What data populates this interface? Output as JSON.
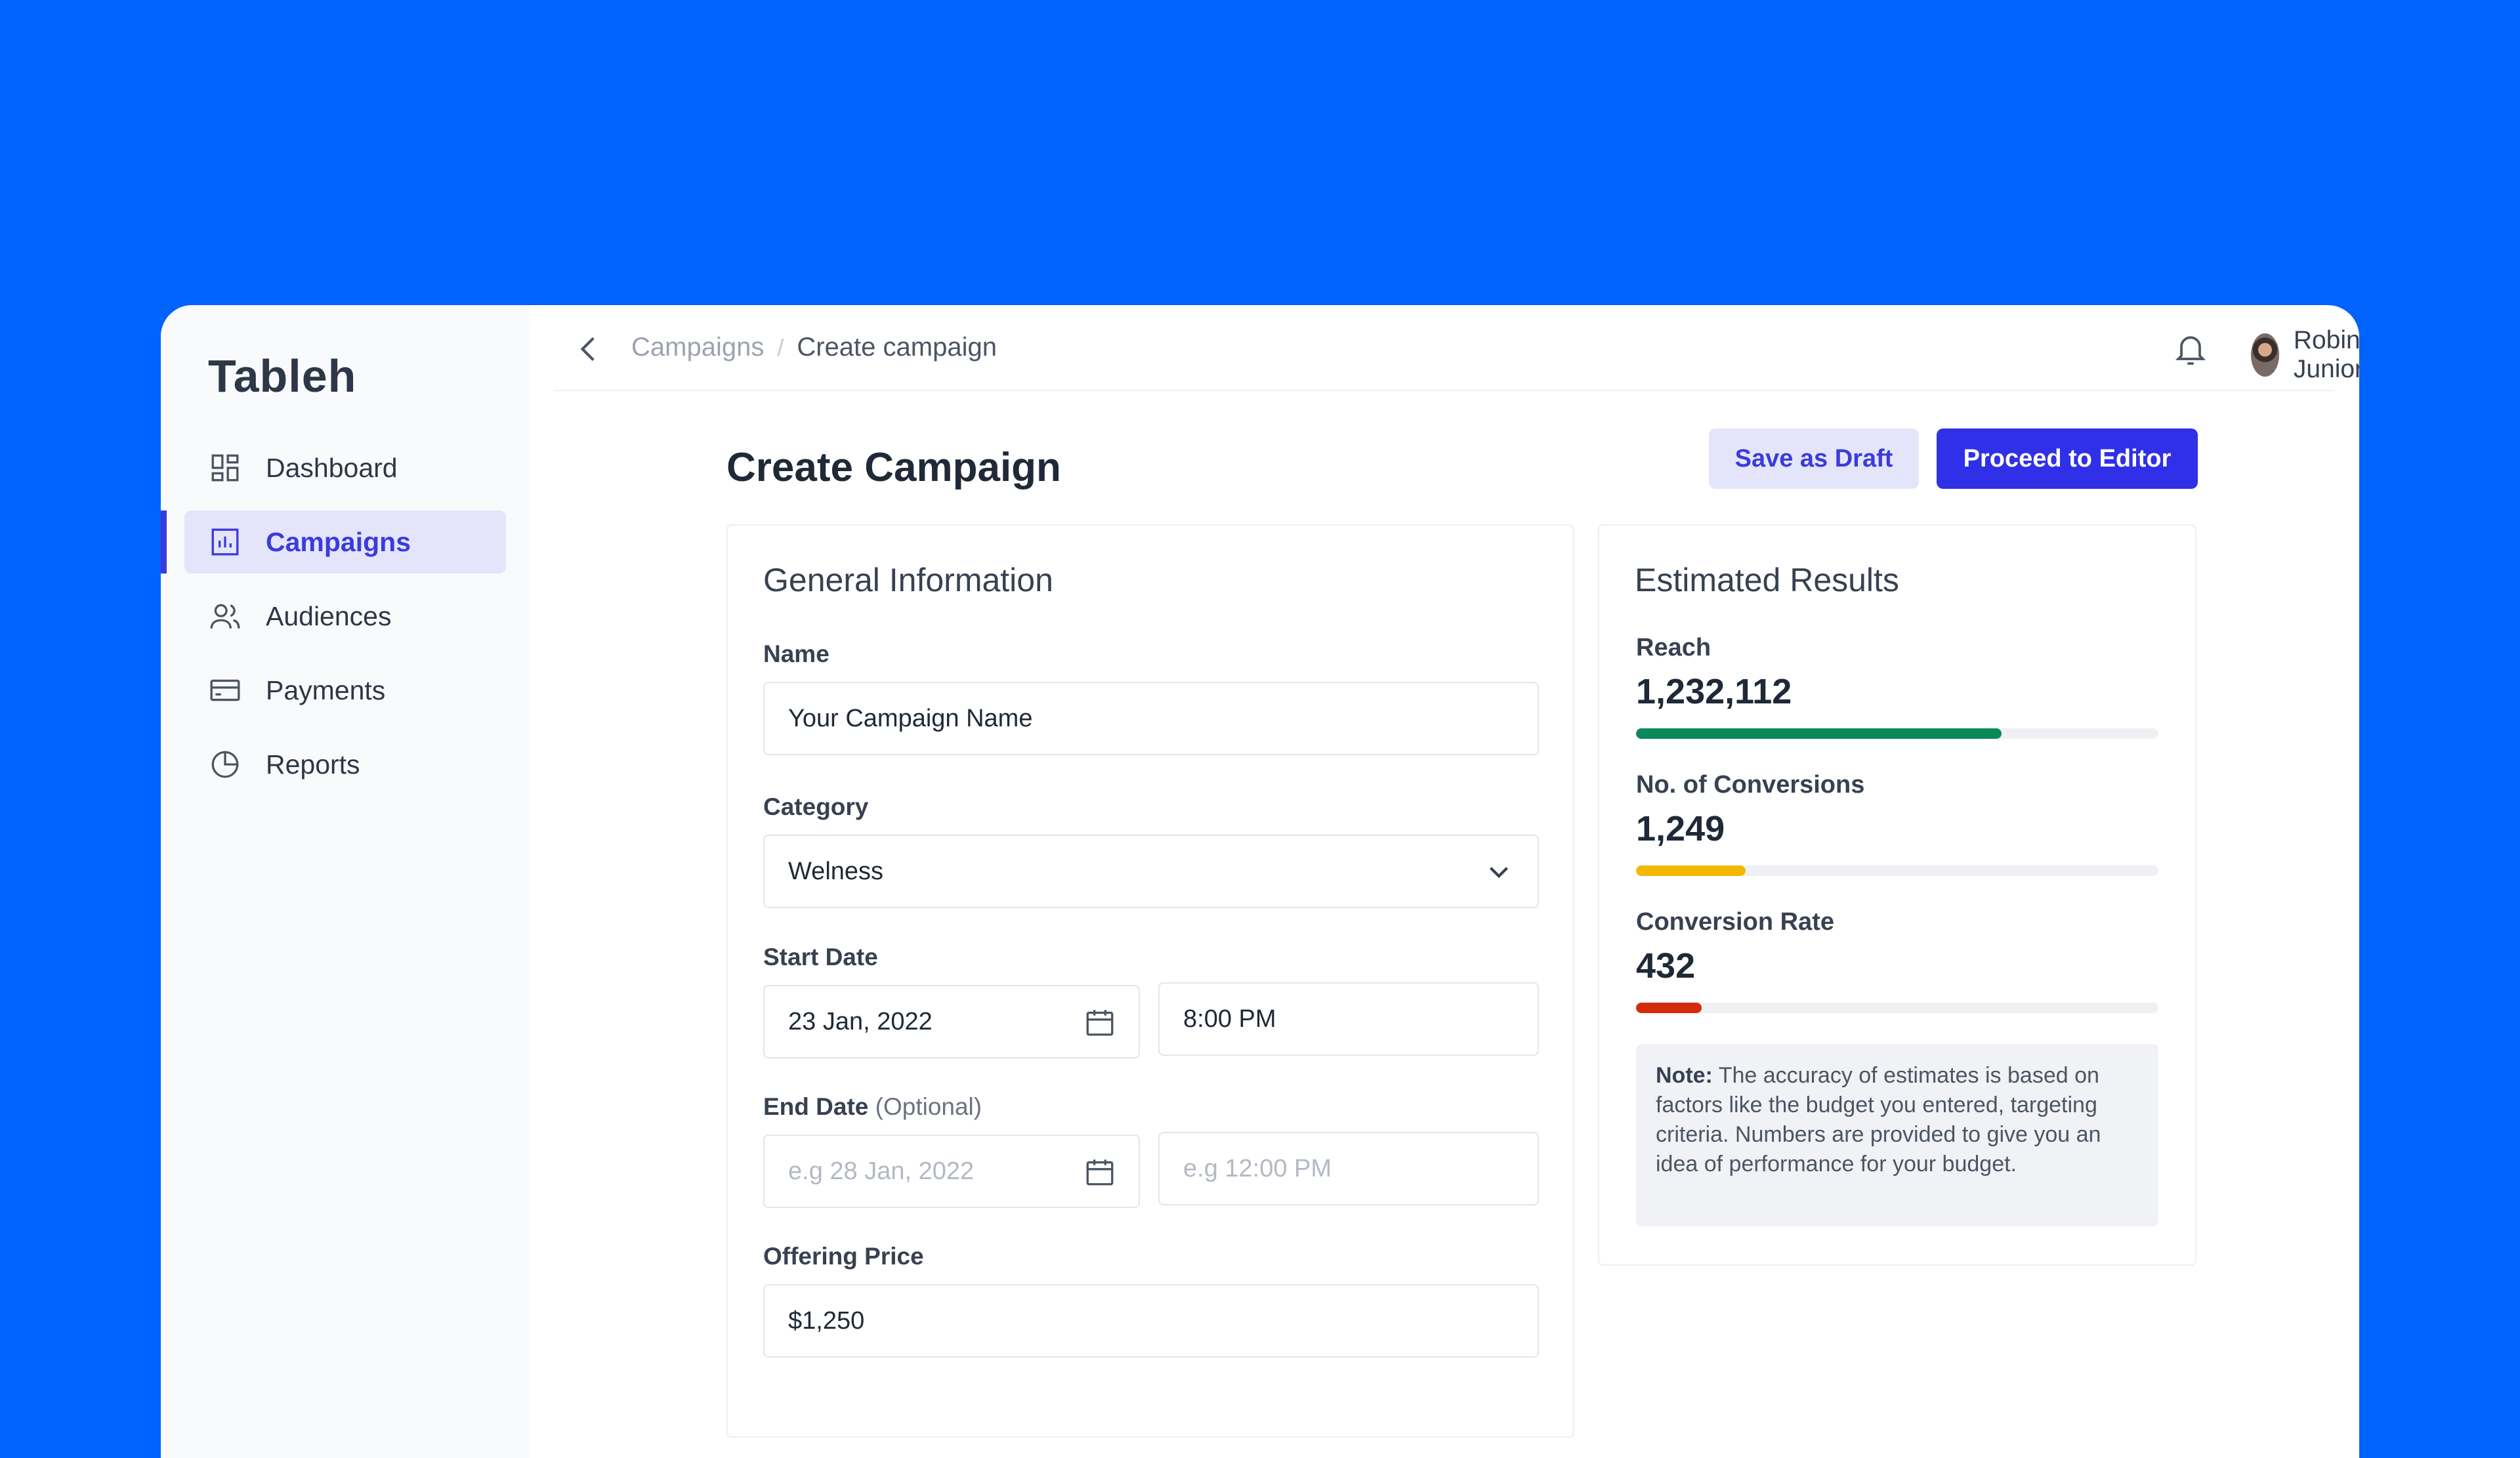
{
  "app": {
    "name": "Tableh"
  },
  "sidebar": {
    "items": [
      {
        "label": "Dashboard",
        "icon": "dashboard-icon"
      },
      {
        "label": "Campaigns",
        "icon": "bar-chart-icon",
        "active": true
      },
      {
        "label": "Audiences",
        "icon": "users-icon"
      },
      {
        "label": "Payments",
        "icon": "credit-card-icon"
      },
      {
        "label": "Reports",
        "icon": "pie-chart-icon"
      }
    ]
  },
  "header": {
    "breadcrumb": [
      "Campaigns",
      "Create campaign"
    ],
    "separator": "/",
    "user_name": "Robin Junior"
  },
  "page": {
    "title": "Create Campaign",
    "save_draft_label": "Save as Draft",
    "proceed_label": "Proceed to Editor"
  },
  "general": {
    "title": "General Information",
    "name_label": "Name",
    "name_value": "Your Campaign Name",
    "category_label": "Category",
    "category_value": "Welness",
    "start_label": "Start Date",
    "start_date": "23 Jan, 2022",
    "start_time": "8:00 PM",
    "end_label": "End Date",
    "end_optional": "(Optional)",
    "end_date_placeholder": "e.g 28 Jan, 2022",
    "end_time_placeholder": "e.g 12:00 PM",
    "price_label": "Offering Price",
    "price_value": "$1,250"
  },
  "results": {
    "title": "Estimated Results",
    "metrics": [
      {
        "label": "Reach",
        "value": "1,232,112",
        "fill": 0.7,
        "color": "#0a8a5a"
      },
      {
        "label": "No. of Conversions",
        "value": "1,249",
        "fill": 0.21,
        "color": "#f5b800"
      },
      {
        "label": "Conversion Rate",
        "value": "432",
        "fill": 0.125,
        "color": "#d42b0b"
      }
    ],
    "note_bold": "Note:",
    "note_text": "The accuracy of estimates is based on factors like the budget you entered, targeting criteria. Numbers are provided to give you an idea of performance for your budget."
  },
  "colors": {
    "background": "#0062ff",
    "accent": "#3b3bdc",
    "primary_button": "#3030e8"
  }
}
